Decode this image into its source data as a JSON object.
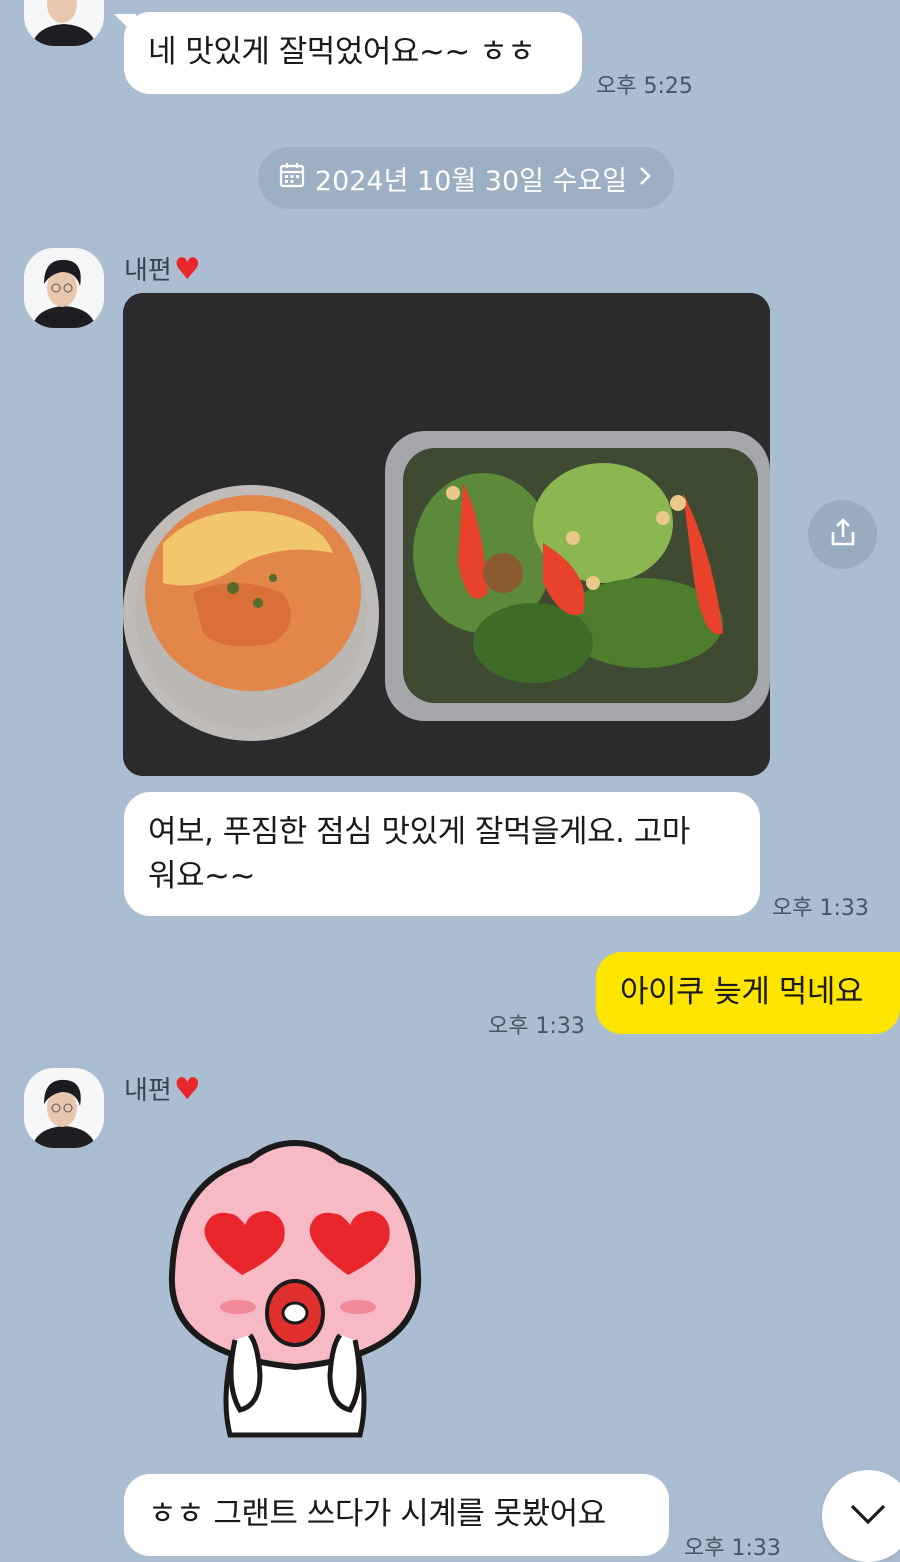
{
  "messages": [
    {
      "id": "m1",
      "text": "네 맛있게 잘먹었어요~~ ㅎㅎ",
      "time": "오후 5:25"
    },
    {
      "id": "m2",
      "text": "여보, 푸짐한 점심 맛있게 잘먹을게요. 고마\n워요~~",
      "time": "오후 1:33"
    },
    {
      "id": "m3",
      "text": "아이쿠 늦게 먹네요",
      "time": "오후 1:33"
    },
    {
      "id": "m4",
      "text": "ㅎㅎ 그랜트 쓰다가 시계를 못봤어요",
      "time": "오후 1:33"
    }
  ],
  "date_divider": {
    "label": "2024년 10월 30일 수요일",
    "icon": "calendar-icon",
    "chevron": ">"
  },
  "sender": {
    "name": "내편",
    "heart": "❤️"
  },
  "icons": {
    "share": "share-icon",
    "scroll": "chevron-down-icon"
  },
  "colors": {
    "background": "#abbdd0",
    "outgoing_bubble": "#fee500",
    "incoming_bubble": "#ffffff"
  }
}
